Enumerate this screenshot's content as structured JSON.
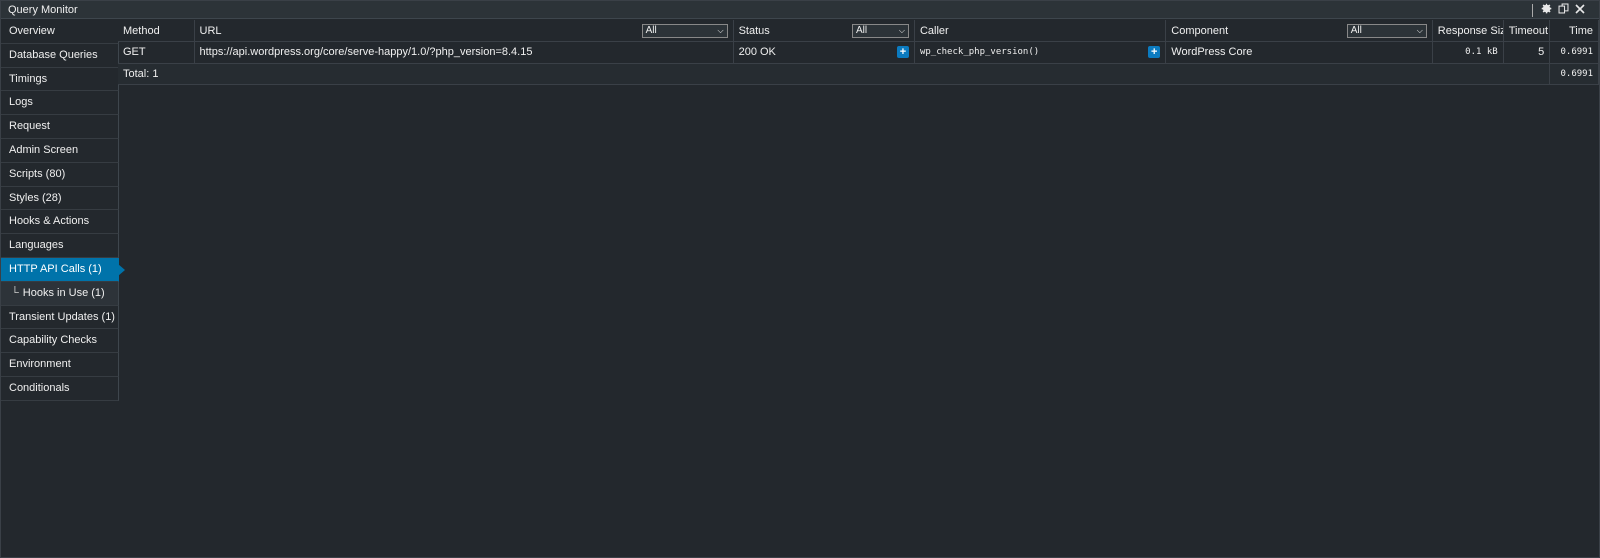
{
  "window": {
    "title": "Query Monitor",
    "icons": [
      "gear-icon",
      "dock-toggle-icon",
      "close-icon"
    ]
  },
  "sidebar": {
    "items": [
      {
        "label": "Overview"
      },
      {
        "label": "Database Queries"
      },
      {
        "label": "Timings"
      },
      {
        "label": "Logs"
      },
      {
        "label": "Request"
      },
      {
        "label": "Admin Screen"
      },
      {
        "label": "Scripts (80)"
      },
      {
        "label": "Styles (28)"
      },
      {
        "label": "Hooks & Actions"
      },
      {
        "label": "Languages"
      },
      {
        "label": "HTTP API Calls (1)"
      },
      {
        "label": "Hooks in Use (1)"
      },
      {
        "label": "Transient Updates (1)"
      },
      {
        "label": "Capability Checks"
      },
      {
        "label": "Environment"
      },
      {
        "label": "Conditionals"
      }
    ],
    "active": "HTTP API Calls (1)"
  },
  "table": {
    "headers": {
      "method": "Method",
      "url": "URL",
      "status": "Status",
      "caller": "Caller",
      "component": "Component",
      "response_size": "Response Size",
      "timeout": "Timeout",
      "time": "Time"
    },
    "filters": {
      "url": "All",
      "status": "All",
      "component": "All"
    },
    "rows": [
      {
        "method": "GET",
        "url": "https://api.wordpress.org/core/serve-happy/1.0/?php_version=8.4.15",
        "status": "200 OK",
        "caller": "wp_check_php_version()",
        "component": "WordPress Core",
        "response_size": "0.1 kB",
        "timeout": "5",
        "time": "0.6991"
      }
    ],
    "total_label": "Total: 1",
    "total_time": "0.6991"
  }
}
